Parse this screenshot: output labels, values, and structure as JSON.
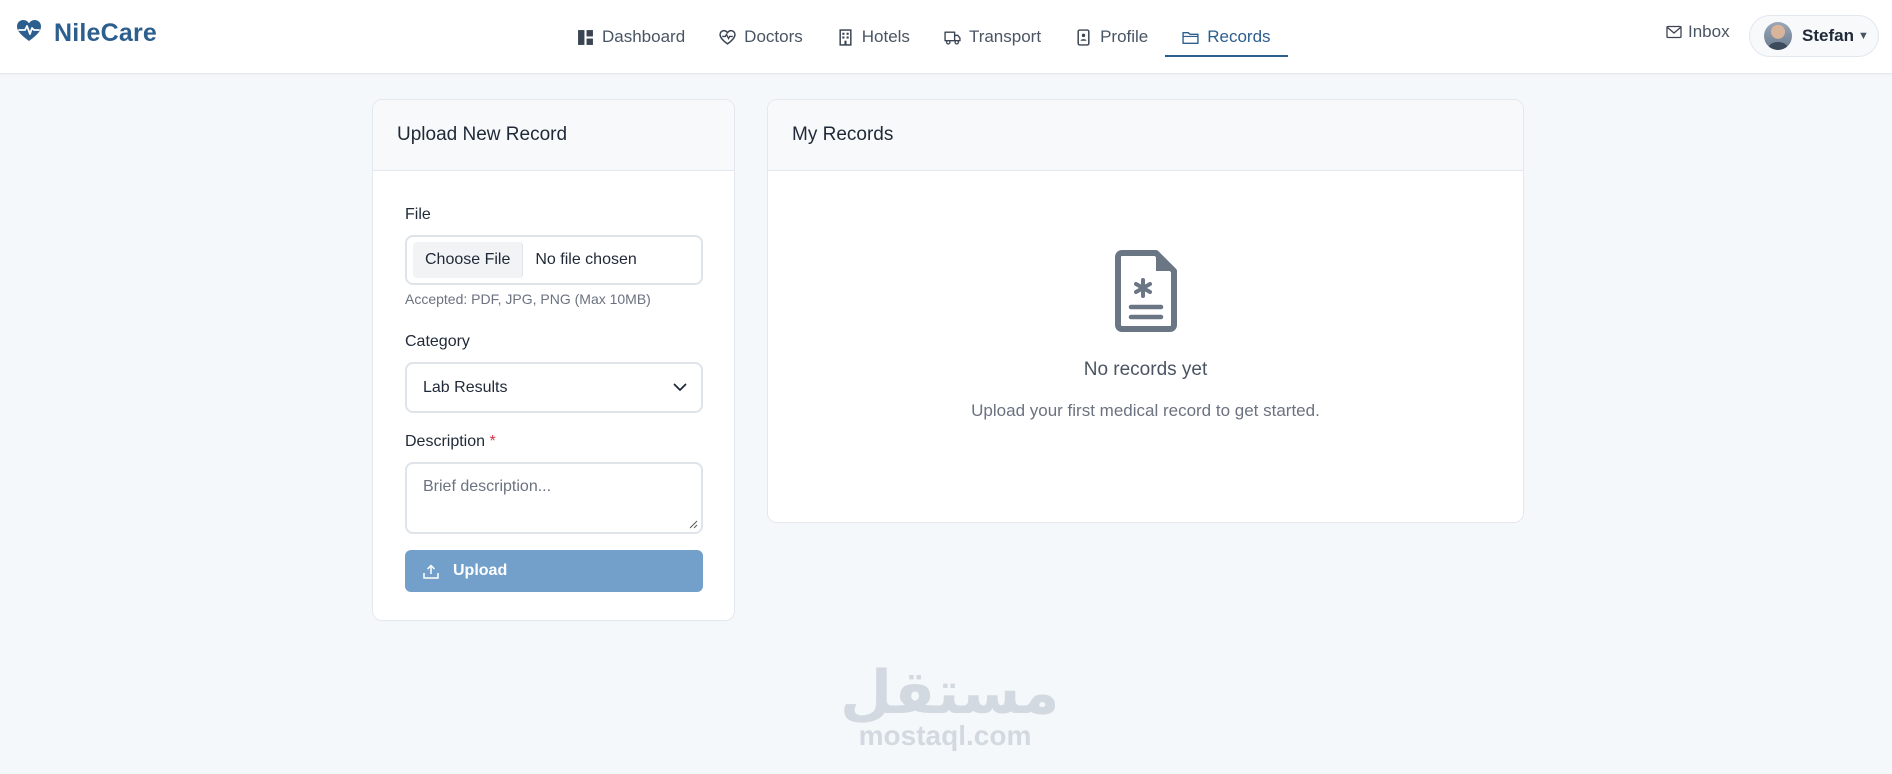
{
  "brand": {
    "name": "NileCare",
    "color": "#2c5e8e"
  },
  "nav": {
    "items": [
      {
        "label": "Dashboard",
        "icon": "dashboard-icon"
      },
      {
        "label": "Doctors",
        "icon": "heart-pulse-icon"
      },
      {
        "label": "Hotels",
        "icon": "building-icon"
      },
      {
        "label": "Transport",
        "icon": "truck-icon"
      },
      {
        "label": "Profile",
        "icon": "id-card-icon"
      },
      {
        "label": "Records",
        "icon": "folder-icon",
        "active": true
      }
    ],
    "inbox_label": "Inbox",
    "user_name": "Stefan"
  },
  "upload": {
    "title": "Upload New Record",
    "file_label": "File",
    "choose_file": "Choose File",
    "no_file": "No file chosen",
    "accepted_hint": "Accepted: PDF, JPG, PNG (Max 10MB)",
    "category_label": "Category",
    "category_value": "Lab Results",
    "description_label": "Description",
    "required_mark": "*",
    "description_placeholder": "Brief description...",
    "button_label": "Upload",
    "button_color": "#72a0cb"
  },
  "records": {
    "title": "My Records",
    "empty_title": "No records yet",
    "empty_subtitle": "Upload your first medical record to get started."
  },
  "watermark": {
    "arabic": "مستقل",
    "latin": "mostaql.com"
  }
}
